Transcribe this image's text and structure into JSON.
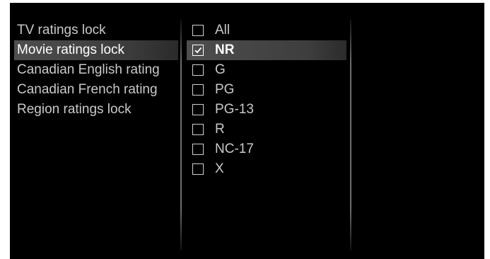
{
  "menu": {
    "items": [
      {
        "label": "TV ratings lock",
        "selected": false
      },
      {
        "label": "Movie ratings lock",
        "selected": true
      },
      {
        "label": "Canadian English rating",
        "selected": false
      },
      {
        "label": "Canadian French rating",
        "selected": false
      },
      {
        "label": "Region ratings lock",
        "selected": false
      }
    ]
  },
  "ratings": {
    "items": [
      {
        "label": "All",
        "checked": false,
        "selected": false
      },
      {
        "label": "NR",
        "checked": true,
        "selected": true
      },
      {
        "label": "G",
        "checked": false,
        "selected": false
      },
      {
        "label": "PG",
        "checked": false,
        "selected": false
      },
      {
        "label": "PG-13",
        "checked": false,
        "selected": false
      },
      {
        "label": "R",
        "checked": false,
        "selected": false
      },
      {
        "label": "NC-17",
        "checked": false,
        "selected": false
      },
      {
        "label": "X",
        "checked": false,
        "selected": false
      }
    ]
  },
  "icons": {
    "checkbox": "checkbox-icon",
    "checkmark": "checkmark-icon"
  },
  "colors": {
    "background": "#000000",
    "text": "#c9c9c9",
    "selected_text": "#ffffff",
    "highlight": "#4e4e4e"
  }
}
